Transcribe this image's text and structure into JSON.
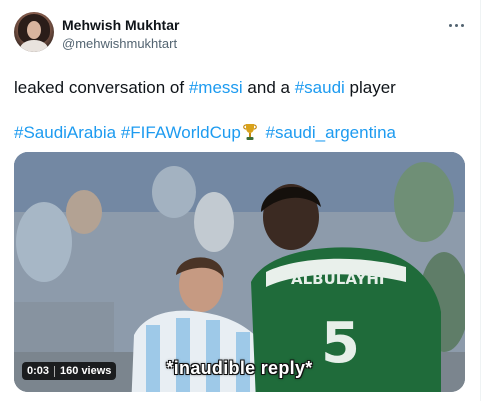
{
  "user": {
    "display_name": "Mehwish Mukhtar",
    "handle": "@mehwishmukhtart"
  },
  "tweet": {
    "line1": {
      "pre": "leaked conversation of ",
      "tag1": "#messi",
      "mid": " and a ",
      "tag2": "#saudi",
      "post": " player"
    },
    "line2": {
      "tag1": "#SaudiArabia",
      "tag2": "#FIFAWorldCup",
      "tag3": "#saudi_argentina"
    }
  },
  "video": {
    "caption": "*inaudible reply*",
    "time": "0:03",
    "views": "160 views",
    "jersey_name": "ALBULAYHI",
    "jersey_number": "5"
  },
  "colors": {
    "link": "#1d9bf0",
    "text": "#0f1419",
    "secondary": "#536471"
  }
}
